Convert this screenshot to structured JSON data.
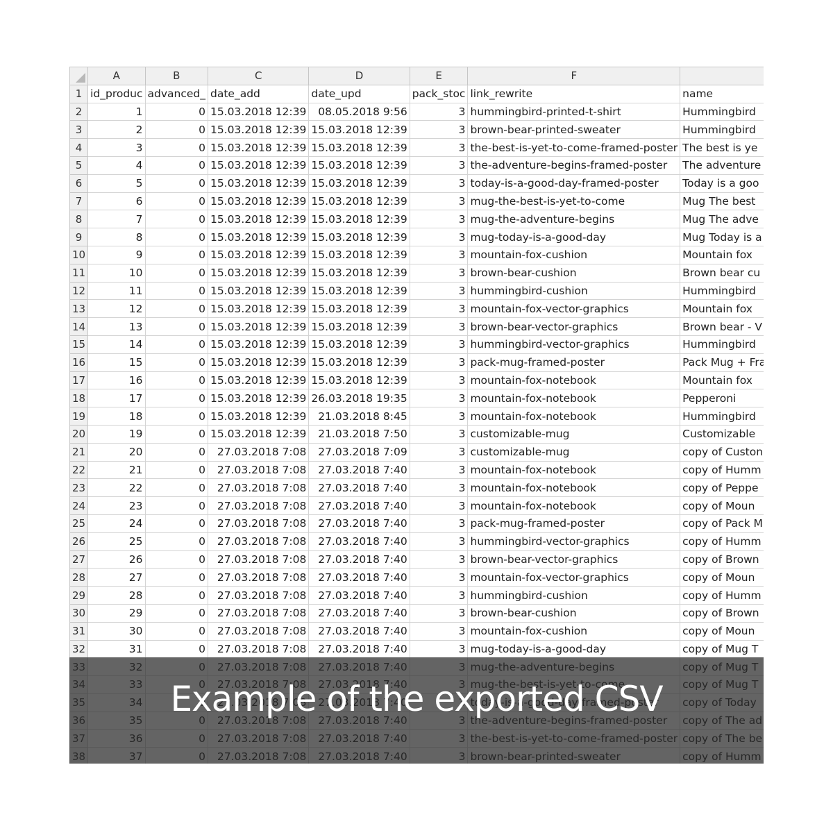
{
  "caption": "Example of the exported CSV",
  "spreadsheet": {
    "column_letters": [
      "A",
      "B",
      "C",
      "D",
      "E",
      "F",
      ""
    ],
    "headers": [
      "id_produc",
      "advanced_",
      "date_add",
      "date_upd",
      "pack_stoc",
      "link_rewrite",
      "name"
    ],
    "rows": [
      [
        "2",
        "1",
        "0",
        "15.03.2018 12:39",
        "08.05.2018 9:56",
        "3",
        "hummingbird-printed-t-shirt",
        "Hummingbird"
      ],
      [
        "3",
        "2",
        "0",
        "15.03.2018 12:39",
        "15.03.2018 12:39",
        "3",
        "brown-bear-printed-sweater",
        "Hummingbird"
      ],
      [
        "4",
        "3",
        "0",
        "15.03.2018 12:39",
        "15.03.2018 12:39",
        "3",
        "the-best-is-yet-to-come-framed-poster",
        "The best is ye"
      ],
      [
        "5",
        "4",
        "0",
        "15.03.2018 12:39",
        "15.03.2018 12:39",
        "3",
        "the-adventure-begins-framed-poster",
        "The adventure"
      ],
      [
        "6",
        "5",
        "0",
        "15.03.2018 12:39",
        "15.03.2018 12:39",
        "3",
        "today-is-a-good-day-framed-poster",
        "Today is a goo"
      ],
      [
        "7",
        "6",
        "0",
        "15.03.2018 12:39",
        "15.03.2018 12:39",
        "3",
        "mug-the-best-is-yet-to-come",
        "Mug The best"
      ],
      [
        "8",
        "7",
        "0",
        "15.03.2018 12:39",
        "15.03.2018 12:39",
        "3",
        "mug-the-adventure-begins",
        "Mug The adve"
      ],
      [
        "9",
        "8",
        "0",
        "15.03.2018 12:39",
        "15.03.2018 12:39",
        "3",
        "mug-today-is-a-good-day",
        "Mug Today is a"
      ],
      [
        "10",
        "9",
        "0",
        "15.03.2018 12:39",
        "15.03.2018 12:39",
        "3",
        "mountain-fox-cushion",
        "Mountain fox"
      ],
      [
        "11",
        "10",
        "0",
        "15.03.2018 12:39",
        "15.03.2018 12:39",
        "3",
        "brown-bear-cushion",
        "Brown bear cu"
      ],
      [
        "12",
        "11",
        "0",
        "15.03.2018 12:39",
        "15.03.2018 12:39",
        "3",
        "hummingbird-cushion",
        "Hummingbird"
      ],
      [
        "13",
        "12",
        "0",
        "15.03.2018 12:39",
        "15.03.2018 12:39",
        "3",
        "mountain-fox-vector-graphics",
        "Mountain fox"
      ],
      [
        "14",
        "13",
        "0",
        "15.03.2018 12:39",
        "15.03.2018 12:39",
        "3",
        "brown-bear-vector-graphics",
        "Brown bear - V"
      ],
      [
        "15",
        "14",
        "0",
        "15.03.2018 12:39",
        "15.03.2018 12:39",
        "3",
        "hummingbird-vector-graphics",
        "Hummingbird"
      ],
      [
        "16",
        "15",
        "0",
        "15.03.2018 12:39",
        "15.03.2018 12:39",
        "3",
        "pack-mug-framed-poster",
        "Pack Mug + Fra"
      ],
      [
        "17",
        "16",
        "0",
        "15.03.2018 12:39",
        "15.03.2018 12:39",
        "3",
        "mountain-fox-notebook",
        "Mountain fox"
      ],
      [
        "18",
        "17",
        "0",
        "15.03.2018 12:39",
        "26.03.2018 19:35",
        "3",
        "mountain-fox-notebook",
        "Pepperoni"
      ],
      [
        "19",
        "18",
        "0",
        "15.03.2018 12:39",
        "21.03.2018 8:45",
        "3",
        "mountain-fox-notebook",
        "Hummingbird"
      ],
      [
        "20",
        "19",
        "0",
        "15.03.2018 12:39",
        "21.03.2018 7:50",
        "3",
        "customizable-mug",
        "Customizable"
      ],
      [
        "21",
        "20",
        "0",
        "27.03.2018 7:08",
        "27.03.2018 7:09",
        "3",
        "customizable-mug",
        "copy of Custon"
      ],
      [
        "22",
        "21",
        "0",
        "27.03.2018 7:08",
        "27.03.2018 7:40",
        "3",
        "mountain-fox-notebook",
        "copy of Humm"
      ],
      [
        "23",
        "22",
        "0",
        "27.03.2018 7:08",
        "27.03.2018 7:40",
        "3",
        "mountain-fox-notebook",
        "copy of Peppe"
      ],
      [
        "24",
        "23",
        "0",
        "27.03.2018 7:08",
        "27.03.2018 7:40",
        "3",
        "mountain-fox-notebook",
        "copy of Moun"
      ],
      [
        "25",
        "24",
        "0",
        "27.03.2018 7:08",
        "27.03.2018 7:40",
        "3",
        "pack-mug-framed-poster",
        "copy of Pack M"
      ],
      [
        "26",
        "25",
        "0",
        "27.03.2018 7:08",
        "27.03.2018 7:40",
        "3",
        "hummingbird-vector-graphics",
        "copy of Humm"
      ],
      [
        "27",
        "26",
        "0",
        "27.03.2018 7:08",
        "27.03.2018 7:40",
        "3",
        "brown-bear-vector-graphics",
        "copy of Brown"
      ],
      [
        "28",
        "27",
        "0",
        "27.03.2018 7:08",
        "27.03.2018 7:40",
        "3",
        "mountain-fox-vector-graphics",
        "copy of Moun"
      ],
      [
        "29",
        "28",
        "0",
        "27.03.2018 7:08",
        "27.03.2018 7:40",
        "3",
        "hummingbird-cushion",
        "copy of Humm"
      ],
      [
        "30",
        "29",
        "0",
        "27.03.2018 7:08",
        "27.03.2018 7:40",
        "3",
        "brown-bear-cushion",
        "copy of Brown"
      ],
      [
        "31",
        "30",
        "0",
        "27.03.2018 7:08",
        "27.03.2018 7:40",
        "3",
        "mountain-fox-cushion",
        "copy of Moun"
      ],
      [
        "32",
        "31",
        "0",
        "27.03.2018 7:08",
        "27.03.2018 7:40",
        "3",
        "mug-today-is-a-good-day",
        "copy of Mug T"
      ],
      [
        "33",
        "32",
        "0",
        "27.03.2018 7:08",
        "27.03.2018 7:40",
        "3",
        "mug-the-adventure-begins",
        "copy of Mug T"
      ],
      [
        "34",
        "33",
        "0",
        "27.03.2018 7:08",
        "27.03.2018 7:40",
        "3",
        "mug-the-best-is-yet-to-come",
        "copy of Mug T"
      ],
      [
        "35",
        "34",
        "0",
        "27.03.2018 7:08",
        "27.03.2018 7:40",
        "3",
        "today-is-a-good-day-framed-poster",
        "copy of Today"
      ],
      [
        "36",
        "35",
        "0",
        "27.03.2018 7:08",
        "27.03.2018 7:40",
        "3",
        "the-adventure-begins-framed-poster",
        "copy of The ad"
      ],
      [
        "37",
        "36",
        "0",
        "27.03.2018 7:08",
        "27.03.2018 7:40",
        "3",
        "the-best-is-yet-to-come-framed-poster",
        "copy of The be"
      ],
      [
        "38",
        "37",
        "0",
        "27.03.2018 7:08",
        "27.03.2018 7:40",
        "3",
        "brown-bear-printed-sweater",
        "copy of Humm"
      ]
    ]
  }
}
